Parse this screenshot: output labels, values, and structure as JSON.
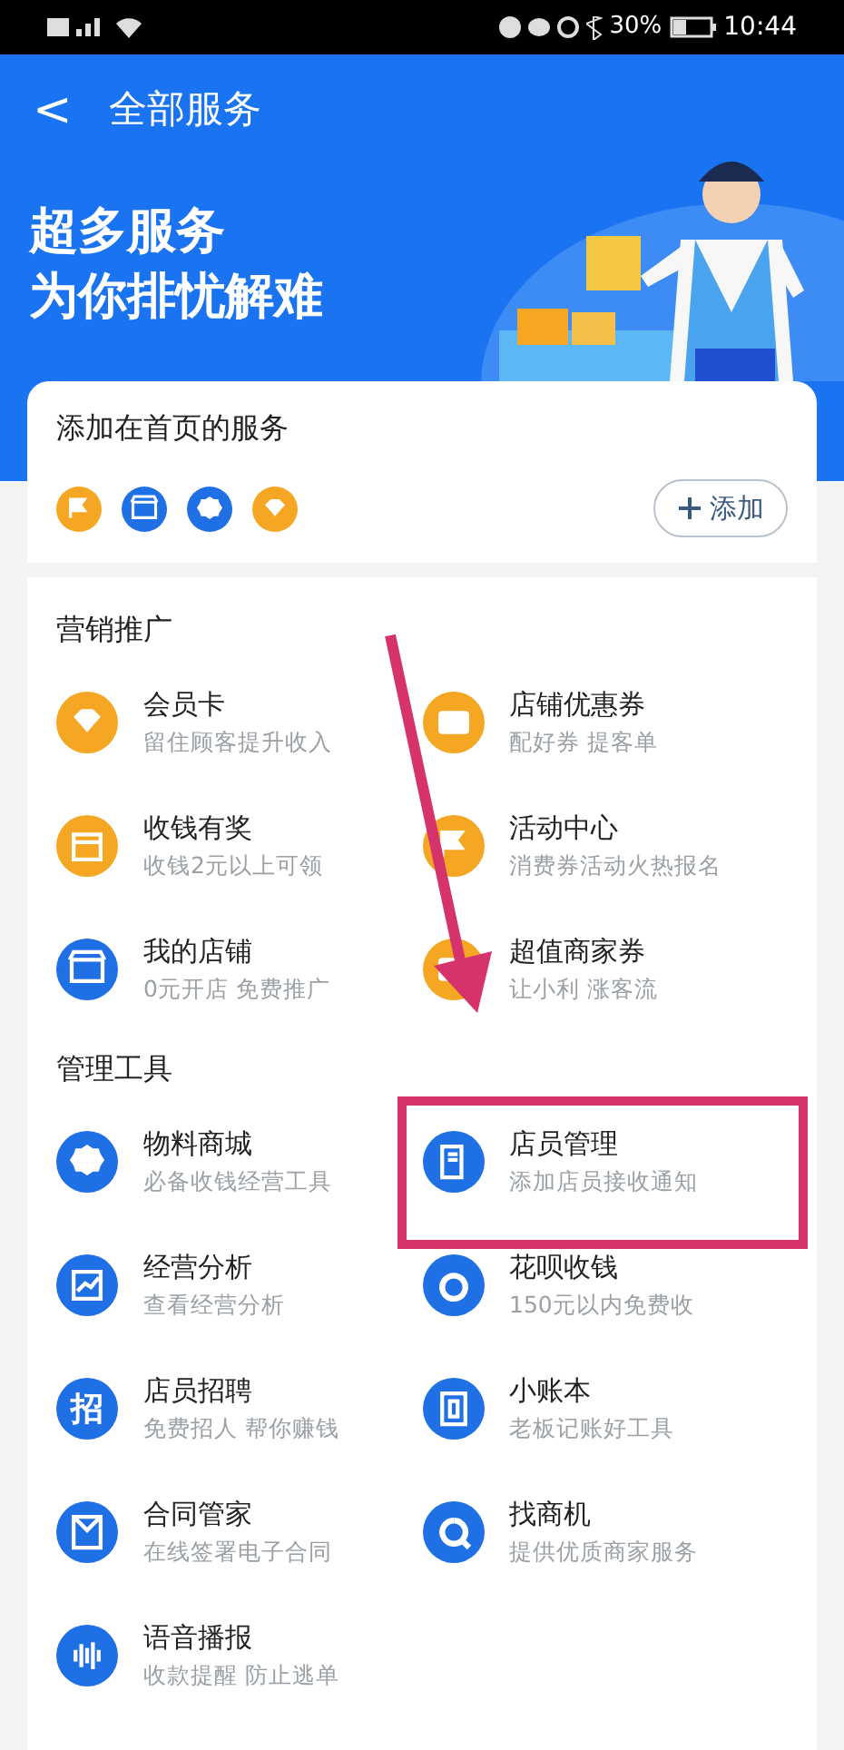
{
  "status_bar": {
    "battery": "30%",
    "time": "10:44"
  },
  "header": {
    "back": "<",
    "title": "全部服务"
  },
  "banner": {
    "lines": [
      "超多服务",
      "为你排忧解难"
    ]
  },
  "pinned": {
    "title": "添加在首页的服务",
    "icons": [
      {
        "kind": "flag",
        "color": "#f5a623"
      },
      {
        "kind": "store",
        "color": "#1f6fe5"
      },
      {
        "kind": "gear",
        "color": "#1f6fe5"
      },
      {
        "kind": "diamond",
        "color": "#f5a623"
      }
    ],
    "add_button": "添加"
  },
  "sections": [
    {
      "title": "营销推广",
      "items": [
        {
          "name": "会员卡",
          "desc": "留住顾客提升收入",
          "kind": "diamond",
          "color": "#f5a623",
          "highlighted": false
        },
        {
          "name": "店铺优惠券",
          "desc": "配好券 提客单",
          "kind": "ticket",
          "color": "#f5a623",
          "highlighted": false
        },
        {
          "name": "收钱有奖",
          "desc": "收钱2元以上可领",
          "kind": "gift",
          "color": "#f5a623",
          "highlighted": false
        },
        {
          "name": "活动中心",
          "desc": "消费券活动火热报名",
          "kind": "flag",
          "color": "#f5a623",
          "highlighted": false
        },
        {
          "name": "我的店铺",
          "desc": "0元开店 免费推广",
          "kind": "store",
          "color": "#1f6fe5",
          "highlighted": false
        },
        {
          "name": "超值商家券",
          "desc": "让小利 涨客流",
          "kind": "ticket",
          "color": "#f5a623",
          "highlighted": false
        }
      ]
    },
    {
      "title": "管理工具",
      "items": [
        {
          "name": "物料商城",
          "desc": "必备收钱经营工具",
          "kind": "gear",
          "color": "#1f6fe5",
          "highlighted": false
        },
        {
          "name": "店员管理",
          "desc": "添加店员接收通知",
          "kind": "document",
          "color": "#1f6fe5",
          "highlighted": true
        },
        {
          "name": "经营分析",
          "desc": "查看经营分析",
          "kind": "chart",
          "color": "#1f6fe5",
          "highlighted": false
        },
        {
          "name": "花呗收钱",
          "desc": "150元以内免费收",
          "kind": "ring",
          "color": "#1f6fe5",
          "highlighted": false
        },
        {
          "name": "店员招聘",
          "desc": "免费招人 帮你赚钱",
          "kind": "glyph",
          "glyph": "招",
          "color": "#1f6fe5",
          "highlighted": false
        },
        {
          "name": "小账本",
          "desc": "老板记账好工具",
          "kind": "book",
          "color": "#1f6fe5",
          "highlighted": false
        },
        {
          "name": "合同管家",
          "desc": "在线签署电子合同",
          "kind": "contract",
          "color": "#1f6fe5",
          "highlighted": false
        },
        {
          "name": "找商机",
          "desc": "提供优质商家服务",
          "kind": "search",
          "color": "#1f6fe5",
          "highlighted": false
        },
        {
          "name": "语音播报",
          "desc": "收款提醒 防止逃单",
          "kind": "voice",
          "color": "#1f6fe5",
          "highlighted": false
        }
      ]
    }
  ],
  "pointer_arrow": true
}
